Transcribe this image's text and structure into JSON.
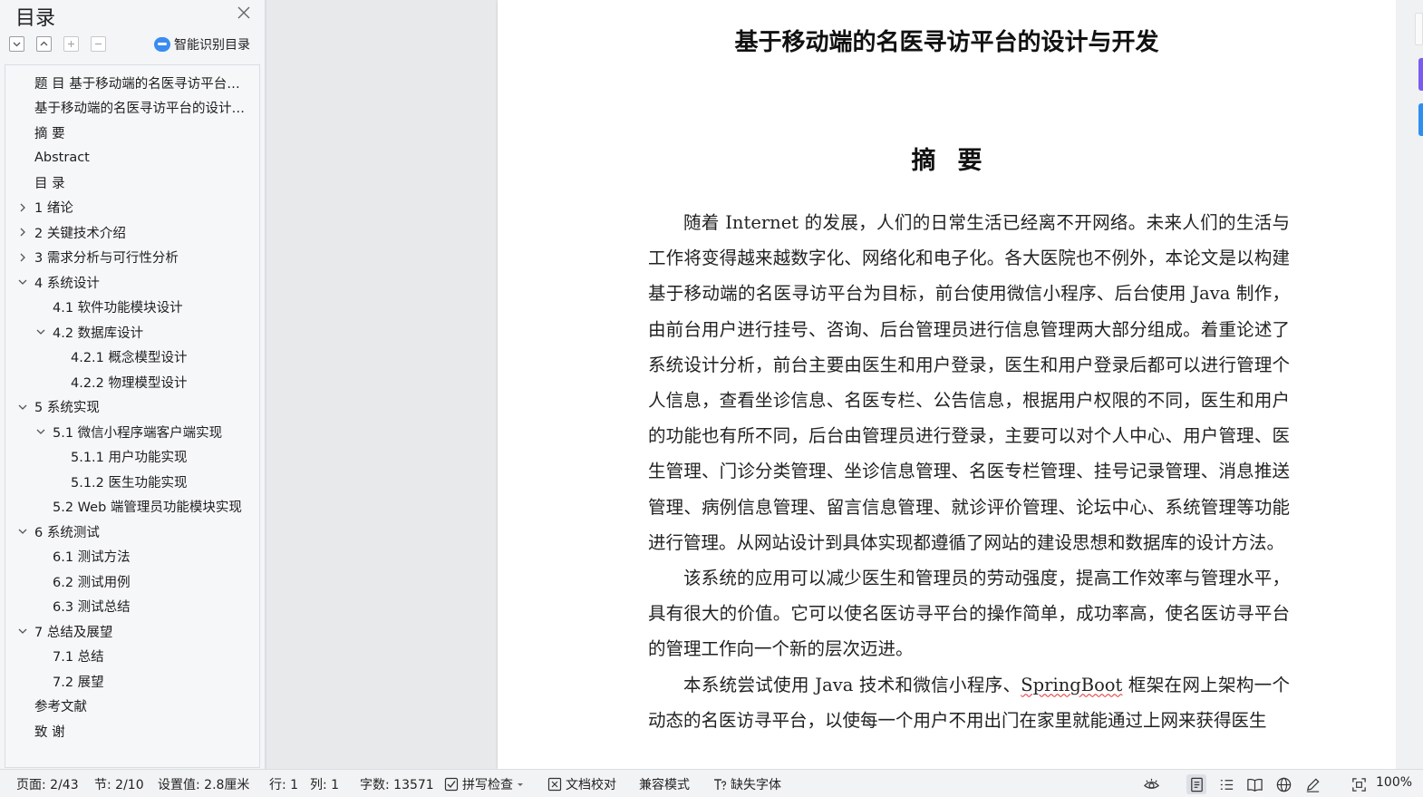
{
  "toc_panel": {
    "title": "目录",
    "toolbar": {
      "expand_all_icon": "chevron-down-square-icon",
      "collapse_all_icon": "chevron-up-square-icon",
      "add_icon": "plus-square-icon",
      "remove_icon": "minus-square-icon"
    },
    "smart_toc_label": "智能识别目录",
    "items": [
      {
        "label": "题    目      基于移动端的名医寻访平台的设计与开发",
        "level": 0,
        "chevron": ""
      },
      {
        "label": "基于移动端的名医寻访平台的设计与开发",
        "level": 0,
        "chevron": ""
      },
      {
        "label": "摘    要",
        "level": 0,
        "chevron": ""
      },
      {
        "label": "Abstract",
        "level": 0,
        "chevron": ""
      },
      {
        "label": "目    录",
        "level": 0,
        "chevron": ""
      },
      {
        "label": "1 绪论",
        "level": 0,
        "chevron": "right"
      },
      {
        "label": "2  关键技术介绍",
        "level": 0,
        "chevron": "right"
      },
      {
        "label": "3  需求分析与可行性分析",
        "level": 0,
        "chevron": "right"
      },
      {
        "label": "4  系统设计",
        "level": 0,
        "chevron": "down"
      },
      {
        "label": "4.1 软件功能模块设计",
        "level": 1,
        "chevron": ""
      },
      {
        "label": "4.2  数据库设计",
        "level": 1,
        "chevron": "down"
      },
      {
        "label": "4.2.1  概念模型设计",
        "level": 2,
        "chevron": ""
      },
      {
        "label": "4.2.2  物理模型设计",
        "level": 2,
        "chevron": ""
      },
      {
        "label": "5 系统实现",
        "level": 0,
        "chevron": "down"
      },
      {
        "label": "5.1 微信小程序端客户端实现",
        "level": 1,
        "chevron": "down"
      },
      {
        "label": "5.1.1 用户功能实现",
        "level": 2,
        "chevron": ""
      },
      {
        "label": "5.1.2 医生功能实现",
        "level": 2,
        "chevron": ""
      },
      {
        "label": "5.2 Web 端管理员功能模块实现",
        "level": 1,
        "chevron": ""
      },
      {
        "label": "6  系统测试",
        "level": 0,
        "chevron": "down"
      },
      {
        "label": "6.1 测试方法",
        "level": 1,
        "chevron": ""
      },
      {
        "label": "6.2 测试用例",
        "level": 1,
        "chevron": ""
      },
      {
        "label": "6.3  测试总结",
        "level": 1,
        "chevron": ""
      },
      {
        "label": "7 总结及展望",
        "level": 0,
        "chevron": "down"
      },
      {
        "label": "7.1  总结",
        "level": 1,
        "chevron": ""
      },
      {
        "label": "7.2  展望",
        "level": 1,
        "chevron": ""
      },
      {
        "label": "参考文献",
        "level": 0,
        "chevron": ""
      },
      {
        "label": "致    谢",
        "level": 0,
        "chevron": ""
      }
    ]
  },
  "document": {
    "title": "基于移动端的名医寻访平台的设计与开发",
    "abstract_heading": "摘要",
    "paragraphs": [
      "随着 Internet 的发展，人们的日常生活已经离不开网络。未来人们的生活与工作将变得越来越数字化、网络化和电子化。各大医院也不例外，本论文是以构建基于移动端的名医寻访平台为目标，前台使用微信小程序、后台使用 Java 制作，由前台用户进行挂号、咨询、后台管理员进行信息管理两大部分组成。着重论述了系统设计分析，前台主要由医生和用户登录，医生和用户登录后都可以进行管理个人信息，查看坐诊信息、名医专栏、公告信息，根据用户权限的不同，医生和用户的功能也有所不同，后台由管理员进行登录，主要可以对个人中心、用户管理、医生管理、门诊分类管理、坐诊信息管理、名医专栏管理、挂号记录管理、消息推送管理、病例信息管理、留言信息管理、就诊评价管理、论坛中心、系统管理等功能进行管理。从网站设计到具体实现都遵循了网站的建设思想和数据库的设计方法。",
      "该系统的应用可以减少医生和管理员的劳动强度，提高工作效率与管理水平，具有很大的价值。它可以使名医访寻平台的操作简单，成功率高，使名医访寻平台的管理工作向一个新的层次迈进。"
    ],
    "paragraph3": {
      "before": "本系统尝试使用 Java 技术和微信小程序、",
      "flagged": "SpringBoot",
      "after": " 框架在网上架构一个动态的名医访寻平台，以使每一个用户不用出门在家里就能通过上网来获得医生"
    }
  },
  "status_bar": {
    "page": "页面: 2/43",
    "section": "节: 2/10",
    "setting": "设置值: 2.8厘米",
    "row": "行: 1",
    "col": "列: 1",
    "word_count": "字数: 13571",
    "spell_check": "拼写检查",
    "doc_proof": "文档校对",
    "compat_mode": "兼容模式",
    "missing_font": "缺失字体",
    "zoom": "100%"
  },
  "colors": {
    "accent": "#3a8cf0",
    "side_tab_purple": "#7b5cf0",
    "side_tab_blue": "#2f8ff0",
    "spell_error": "#e03030"
  }
}
